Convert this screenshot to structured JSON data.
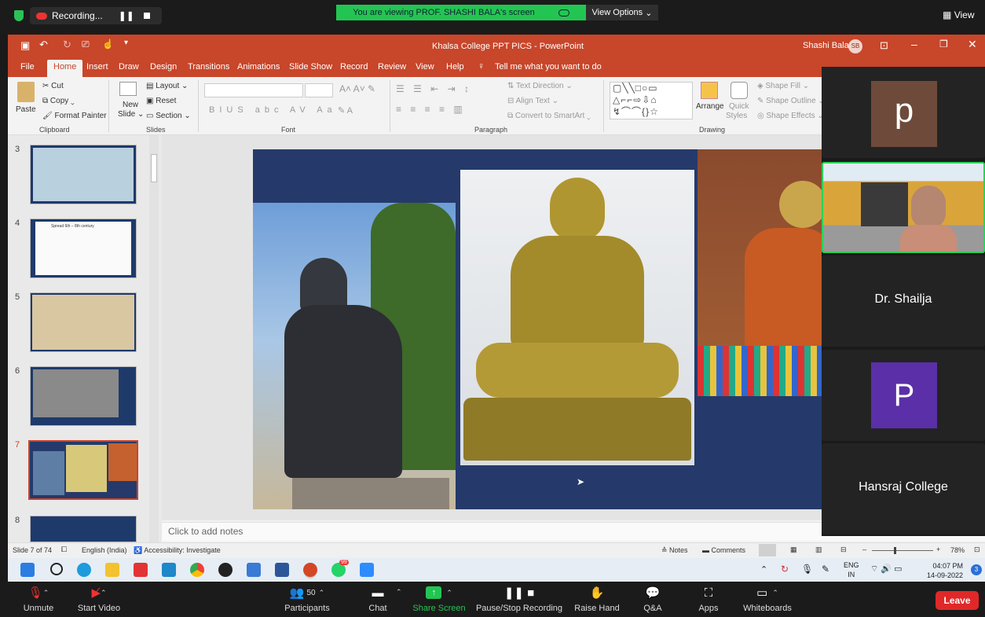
{
  "zoom_top": {
    "recording_label": "Recording...",
    "viewing_banner": "You are viewing PROF. SHASHI BALA's screen",
    "view_options": "View Options",
    "view_button": "View"
  },
  "ppt": {
    "window_title": "Khalsa College PPT PICS  -  PowerPoint",
    "user_name": "Shashi Bala",
    "user_initials": "SB",
    "tabs": [
      "File",
      "Home",
      "Insert",
      "Draw",
      "Design",
      "Transitions",
      "Animations",
      "Slide Show",
      "Record",
      "Review",
      "View",
      "Help"
    ],
    "tell_me": "Tell me what you want to do",
    "ribbon": {
      "paste": "Paste",
      "cut": "Cut",
      "copy": "Copy",
      "format_painter": "Format Painter",
      "clipboard": "Clipboard",
      "new_slide": "New",
      "new_slide2": "Slide",
      "layout": "Layout",
      "reset": "Reset",
      "section": "Section",
      "slides": "Slides",
      "font": "Font",
      "paragraph": "Paragraph",
      "text_direction": "Text Direction",
      "align_text": "Align Text",
      "convert_smartart": "Convert to SmartArt",
      "arrange": "Arrange",
      "quick_styles": "Quick",
      "quick_styles2": "Styles",
      "shape_fill": "Shape Fill",
      "shape_outline": "Shape Outline",
      "shape_effects": "Shape Effects",
      "drawing": "Drawing"
    },
    "thumbnails": [
      "3",
      "4",
      "5",
      "6",
      "7",
      "8"
    ],
    "selected_slide": "7",
    "thumb4_caption": "Spread 6th – 8th century",
    "notes_placeholder": "Click to add notes",
    "status": {
      "slide_of": "Slide 7 of 74",
      "language": "English (India)",
      "accessibility": "Accessibility: Investigate",
      "notes": "Notes",
      "comments": "Comments",
      "zoom": "78%"
    }
  },
  "taskbar": {
    "lang1": "ENG",
    "lang2": "IN",
    "time": "04:07 PM",
    "date": "14-09-2022",
    "whatsapp_badge": "99",
    "notif_badge": "3"
  },
  "gallery": {
    "tile1_letter": "p",
    "tile3_name": "Dr. Shailja",
    "tile4_letter": "P",
    "tile5_name": "Hansraj College"
  },
  "zoom_bottom": {
    "unmute": "Unmute",
    "start_video": "Start Video",
    "participants_count": "50",
    "participants": "Participants",
    "chat": "Chat",
    "share_screen": "Share Screen",
    "pause_recording": "Pause/Stop Recording",
    "raise_hand": "Raise Hand",
    "qa": "Q&A",
    "apps": "Apps",
    "whiteboards": "Whiteboards",
    "leave": "Leave"
  },
  "colors": {
    "ppt_accent": "#c8462a",
    "zoom_green": "#23c552",
    "slide_bg": "#253a6b",
    "leave_red": "#e02828"
  }
}
